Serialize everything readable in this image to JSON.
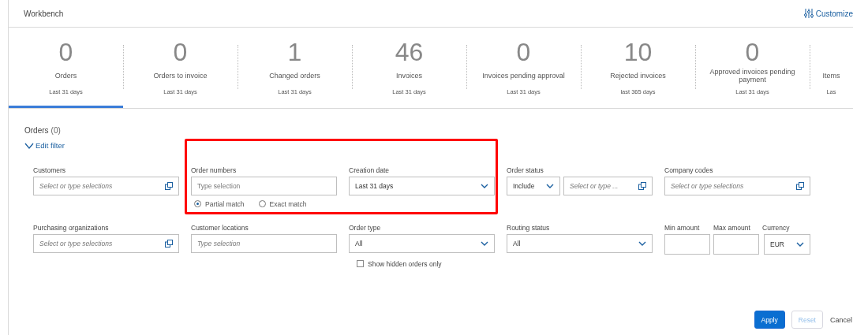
{
  "header": {
    "title": "Workbench",
    "customize": "Customize"
  },
  "tiles": [
    {
      "count": "0",
      "label": "Orders",
      "period": "Last 31 days",
      "selected": true
    },
    {
      "count": "0",
      "label": "Orders to invoice",
      "period": "Last 31 days",
      "selected": false
    },
    {
      "count": "1",
      "label": "Changed orders",
      "period": "Last 31 days",
      "selected": false
    },
    {
      "count": "46",
      "label": "Invoices",
      "period": "Last 31 days",
      "selected": false
    },
    {
      "count": "0",
      "label": "Invoices pending approval",
      "period": "Last 31 days",
      "selected": false
    },
    {
      "count": "10",
      "label": "Rejected invoices",
      "period": "last 365 days",
      "selected": false
    },
    {
      "count": "0",
      "label": "Approved invoices pending payment",
      "period": "Last 31 days",
      "selected": false
    },
    {
      "label": "Items",
      "period": "Las",
      "selected": false
    }
  ],
  "filter": {
    "title": "Orders",
    "count": "(0)",
    "edit": "Edit filter",
    "expanded": true,
    "rows": [
      [
        {
          "kind": "multi",
          "label": "Customers",
          "placeholder": "Select or type selections"
        },
        {
          "kind": "text",
          "label": "Order numbers",
          "placeholder": "Type selection",
          "options": [
            {
              "label": "Partial match",
              "selected": true
            },
            {
              "label": "Exact match",
              "selected": false
            }
          ]
        },
        {
          "kind": "select",
          "label": "Creation date",
          "value": "Last 31 days"
        },
        {
          "kind": "status",
          "label": "Order status",
          "value": "Include",
          "placeholder": "Select or type ..."
        },
        {
          "kind": "multi",
          "label": "Company codes",
          "placeholder": "Select or type selections"
        }
      ],
      [
        {
          "kind": "multi",
          "label": "Purchasing organizations",
          "placeholder": "Select or type selections"
        },
        {
          "kind": "text",
          "label": "Customer locations",
          "placeholder": "Type selection",
          "italic": true
        },
        {
          "kind": "select",
          "label": "Order type",
          "value": "All",
          "checkbox": {
            "label": "Show hidden orders only",
            "checked": false
          }
        },
        {
          "kind": "select",
          "label": "Routing status",
          "value": "All"
        },
        {
          "kind": "amounts",
          "parts": [
            {
              "kind": "text",
              "label": "Min amount"
            },
            {
              "kind": "text",
              "label": "Max amount"
            },
            {
              "kind": "select",
              "label": "Currency",
              "value": "EUR"
            }
          ]
        }
      ]
    ],
    "buttons": [
      {
        "label": "Apply",
        "kind": "primary",
        "disabled": false
      },
      {
        "label": "Reset",
        "kind": "secondary",
        "disabled": true
      },
      {
        "label": "Cancel",
        "kind": "link",
        "disabled": false
      }
    ]
  }
}
